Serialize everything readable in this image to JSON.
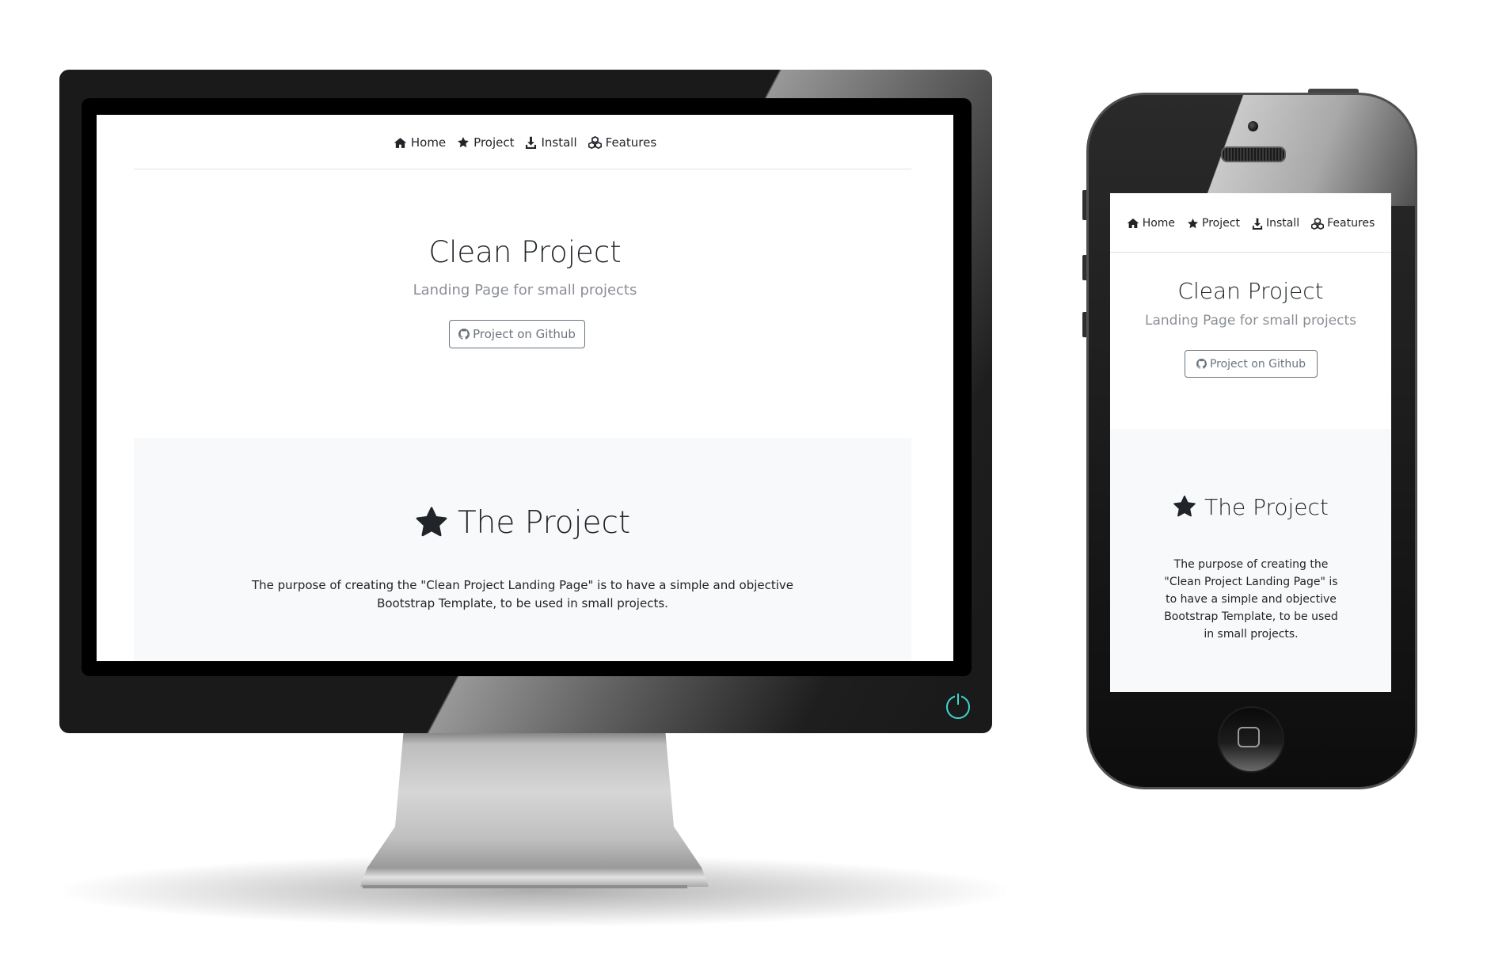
{
  "site": {
    "nav": [
      {
        "label": "Home",
        "icon": "home-icon"
      },
      {
        "label": "Project",
        "icon": "star-icon"
      },
      {
        "label": "Install",
        "icon": "download-icon"
      },
      {
        "label": "Features",
        "icon": "cubes-icon"
      }
    ],
    "hero": {
      "title": "Clean Project",
      "subtitle": "Landing Page for small projects",
      "button_label": "Project on Github",
      "button_icon": "github-icon"
    },
    "project_section": {
      "title": "The Project",
      "title_icon": "star-icon",
      "text": "The purpose of creating the \"Clean Project Landing Page\" is to have a simple and objective Bootstrap Template, to be used in small projects."
    }
  },
  "colors": {
    "text": "#212529",
    "muted": "#6c757d",
    "section_bg": "#f8f9fa",
    "power_led": "#3fd6d0"
  }
}
